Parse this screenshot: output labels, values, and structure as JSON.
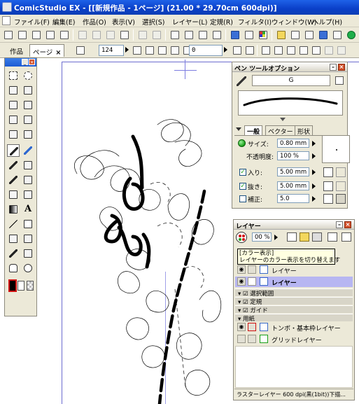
{
  "window": {
    "title": "ComicStudio EX - [[新規作品 - 1ページ] (21.00 * 29.70cm 600dpi)]"
  },
  "menu": [
    "ファイル(F)",
    "編集(E)",
    "作品(O)",
    "表示(V)",
    "選択(S)",
    "レイヤー(L)",
    "定規(R)",
    "フィルタ(I)",
    "ウィンドウ(W)",
    "ヘルプ(H)"
  ],
  "toolbar2": {
    "tab_work": "作品",
    "tab_page": "ページ",
    "tab_close": "×",
    "zoom_value": "124",
    "rotate_value": "0"
  },
  "pen_options": {
    "title": "ペン ツールオプション",
    "pen_name": "G",
    "tabs": [
      "一般",
      "ベクター",
      "形状"
    ],
    "size_label": "サイズ:",
    "size_value": "0.80 mm",
    "opacity_label": "不透明度:",
    "opacity_value": "100 %",
    "in_label": "入り:",
    "in_value": "5.00 mm",
    "out_label": "抜き:",
    "out_value": "5.00 mm",
    "correct_label": "補正:",
    "correct_value": "5.0"
  },
  "layers": {
    "title": "レイヤー",
    "opacity_value": "00 %",
    "tooltip_title": "[カラー表示]",
    "tooltip_text": "レイヤーのカラー表示を切り替えます",
    "rows": [
      {
        "name": "レイヤー",
        "active": false
      },
      {
        "name": "レイヤー",
        "active": true
      }
    ],
    "folders": [
      {
        "name": "選択範囲"
      },
      {
        "name": "定規"
      },
      {
        "name": "ガイド"
      },
      {
        "name": "用紙"
      }
    ],
    "paper_rows": [
      {
        "name": "トンボ・基本枠レイヤー"
      },
      {
        "name": "グリッドレイヤー"
      }
    ],
    "status": "ラスターレイヤー 600 dpi(黒(1bit))下描..."
  },
  "colors": {
    "titlebar": "#0a3fc8",
    "active_layer": "#b7b6f2",
    "page_border": "#6c6cd0"
  }
}
